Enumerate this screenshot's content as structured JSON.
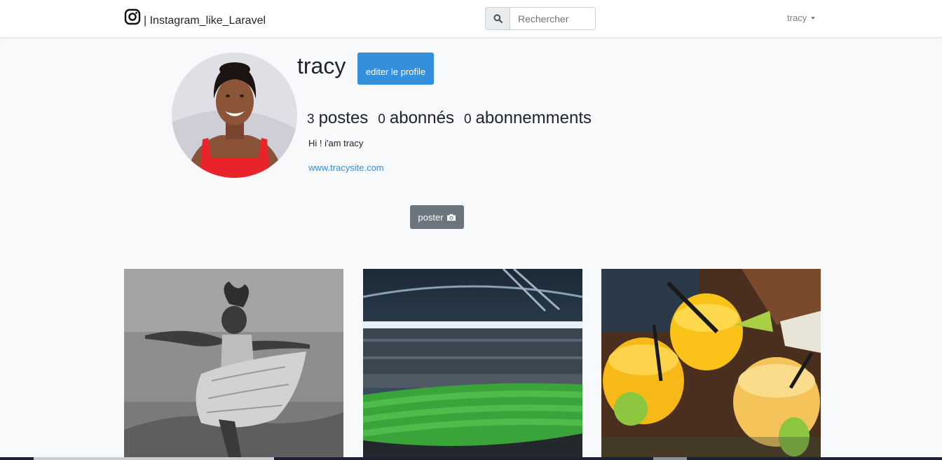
{
  "navbar": {
    "brand_text": "| Instagram_like_Laravel",
    "brand_icon": "instagram-icon",
    "search": {
      "placeholder": "Rechercher",
      "value": "",
      "icon": "search-icon"
    },
    "user_menu_label": "tracy"
  },
  "profile": {
    "username": "tracy",
    "edit_label": "editer le profile",
    "stats": {
      "posts_count": "3",
      "posts_label": "postes",
      "followers_count": "0",
      "followers_label": "abonnés",
      "following_count": "0",
      "following_label": "abonnemments"
    },
    "bio": "Hi ! i'am tracy",
    "website": "www.tracysite.com"
  },
  "actions": {
    "poster_label": "poster",
    "poster_icon": "camera-icon"
  },
  "colors": {
    "primary": "#3490dc",
    "secondary": "#6c757d",
    "background": "#f8f9fa"
  }
}
